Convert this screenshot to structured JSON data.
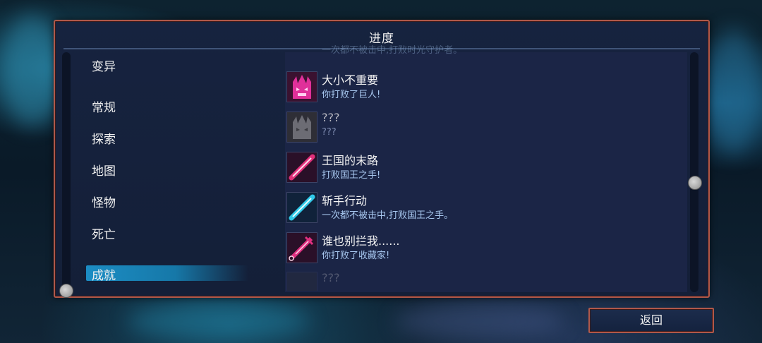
{
  "title": "进度",
  "categories": [
    {
      "label": "变异"
    },
    {
      "label": "常规"
    },
    {
      "label": "探索"
    },
    {
      "label": "地图"
    },
    {
      "label": "怪物"
    },
    {
      "label": "死亡"
    },
    {
      "label": "成就",
      "selected": true
    }
  ],
  "achievements": [
    {
      "name": "",
      "desc": "一次都不被击中,打败时光守护者。",
      "partial": true
    },
    {
      "name": "大小不重要",
      "desc": "你打败了巨人!",
      "icon": "giant-skull-icon",
      "color": "#e0309a"
    },
    {
      "name": "???",
      "desc": "???",
      "icon": "locked-skull-icon",
      "locked": true
    },
    {
      "name": "王国的末路",
      "desc": "打败国王之手!",
      "icon": "pink-blade-icon",
      "color": "#e0307a"
    },
    {
      "name": "斩手行动",
      "desc": "一次都不被击中,打败国王之手。",
      "icon": "cyan-blade-icon",
      "color": "#30c8e8"
    },
    {
      "name": "谁也别拦我......",
      "desc": "你打败了收藏家!",
      "icon": "syringe-icon",
      "color": "#e03080"
    },
    {
      "name": "???",
      "desc": "",
      "icon": "locked-item-icon",
      "locked": true,
      "partial": true
    }
  ],
  "back_button": "返回"
}
